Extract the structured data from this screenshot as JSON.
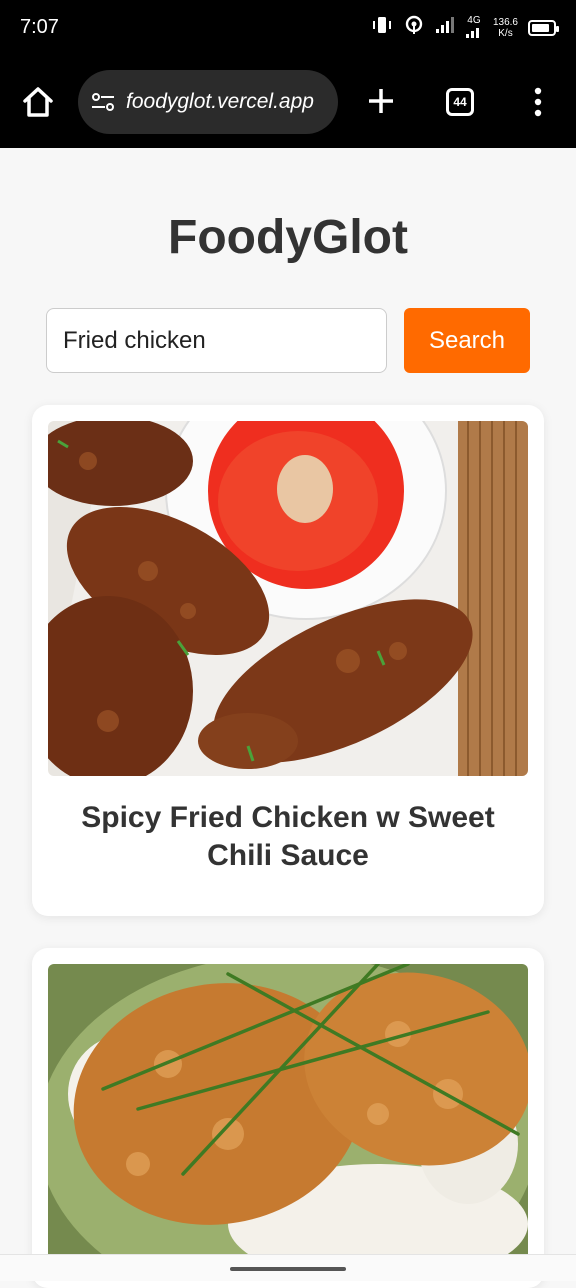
{
  "status_bar": {
    "time": "7:07",
    "net_type": "4G",
    "net_speed": "136.6",
    "net_speed_unit": "K/s"
  },
  "browser": {
    "url": "foodyglot.vercel.app",
    "tab_count": "44",
    "icons": [
      "home-icon",
      "site-settings-icon",
      "plus-icon",
      "tabs-icon",
      "more-vert-icon"
    ]
  },
  "page": {
    "title": "FoodyGlot",
    "search": {
      "value": "Fried chicken",
      "button_label": "Search"
    },
    "accent_color": "#ff6a00",
    "results": [
      {
        "title": "Spicy Fried Chicken w Sweet Chili Sauce",
        "image": "fried-chicken-drumsticks-with-chili-sauce"
      },
      {
        "title": "",
        "image": "breaded-chicken-cutlets-on-mashed-potatoes"
      }
    ]
  }
}
